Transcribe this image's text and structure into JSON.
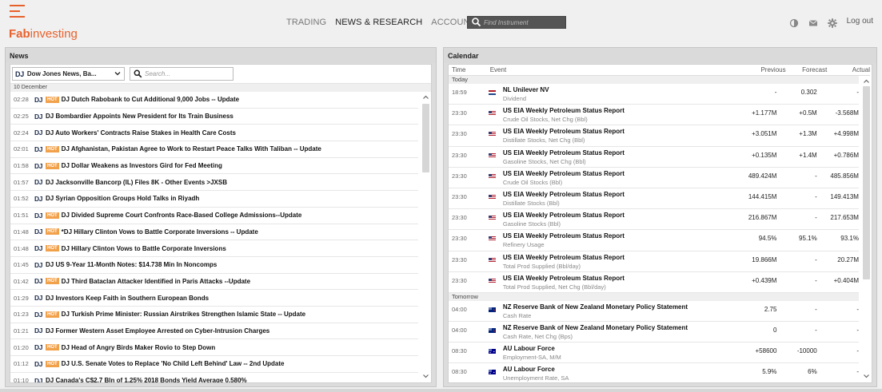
{
  "header": {
    "logo_fab": "Fab",
    "logo_rest": "investing",
    "nav": [
      {
        "label": "TRADING",
        "active": false
      },
      {
        "label": "NEWS & RESEARCH",
        "active": true
      },
      {
        "label": "ACCOUNT",
        "active": false
      }
    ],
    "find_placeholder": "Find Instrument",
    "logout": "Log out",
    "icons": [
      "contrast-icon",
      "mail-icon",
      "gear-icon"
    ]
  },
  "news": {
    "title": "News",
    "source_value": "Dow Jones News, Ba...",
    "source_mark": "DJ",
    "search_placeholder": "Search...",
    "date_label": "10 December",
    "hot_label": "HOT",
    "items": [
      {
        "time": "02:28",
        "hot": true,
        "headline": "DJ Dutch Rabobank to Cut Additional 9,000 Jobs -- Update"
      },
      {
        "time": "02:25",
        "hot": false,
        "headline": "DJ Bombardier Appoints New President for Its Train Business"
      },
      {
        "time": "02:24",
        "hot": false,
        "headline": "DJ Auto Workers' Contracts Raise Stakes in Health Care Costs"
      },
      {
        "time": "02:01",
        "hot": true,
        "headline": "DJ Afghanistan, Pakistan Agree to Work to Restart Peace Talks With Taliban -- Update"
      },
      {
        "time": "01:58",
        "hot": true,
        "headline": "DJ Dollar Weakens as Investors Gird for Fed Meeting"
      },
      {
        "time": "01:57",
        "hot": false,
        "headline": "DJ Jacksonville Bancorp (IL) Files 8K - Other Events >JXSB"
      },
      {
        "time": "01:52",
        "hot": false,
        "headline": "DJ Syrian Opposition Groups Hold Talks in Riyadh"
      },
      {
        "time": "01:51",
        "hot": true,
        "headline": "DJ Divided Supreme Court Confronts Race-Based College Admissions--Update"
      },
      {
        "time": "01:48",
        "hot": true,
        "headline": "*DJ Hillary Clinton Vows to Battle Corporate Inversions -- Update"
      },
      {
        "time": "01:48",
        "hot": true,
        "headline": "DJ Hillary Clinton Vows to Battle Corporate Inversions"
      },
      {
        "time": "01:45",
        "hot": false,
        "headline": "DJ US 9-Year 11-Month Notes: $14.738 Min In Noncomps"
      },
      {
        "time": "01:42",
        "hot": true,
        "headline": "DJ Third Bataclan Attacker Identified in Paris Attacks --Update"
      },
      {
        "time": "01:29",
        "hot": false,
        "headline": "DJ Investors Keep Faith in Southern European Bonds"
      },
      {
        "time": "01:23",
        "hot": true,
        "headline": "DJ Turkish Prime Minister: Russian Airstrikes Strengthen Islamic State -- Update"
      },
      {
        "time": "01:21",
        "hot": false,
        "headline": "DJ Former Western Asset Employee Arrested on Cyber-Intrusion Charges"
      },
      {
        "time": "01:20",
        "hot": true,
        "headline": "DJ Head of Angry Birds Maker Rovio to Step Down"
      },
      {
        "time": "01:12",
        "hot": true,
        "headline": "DJ U.S. Senate Votes to Replace 'No Child Left Behind' Law -- 2nd Update"
      },
      {
        "time": "01:10",
        "hot": false,
        "headline": "DJ Canada's C$2.7 Bln of 1.25% 2018 Bonds Yield Average 0.580%"
      }
    ]
  },
  "calendar": {
    "title": "Calendar",
    "columns": {
      "time": "Time",
      "event": "Event",
      "previous": "Previous",
      "forecast": "Forecast",
      "actual": "Actual"
    },
    "sections": [
      {
        "label": "Today",
        "rows": [
          {
            "time": "18:59",
            "flag": "nl",
            "name": "NL Unilever NV",
            "sub": "Dividend",
            "previous": "-",
            "forecast": "0.302",
            "actual": "-"
          },
          {
            "time": "23:30",
            "flag": "us",
            "name": "US EIA Weekly Petroleum Status Report",
            "sub": "Crude Oil Stocks, Net Chg (Bbl)",
            "previous": "+1.177M",
            "forecast": "+0.5M",
            "actual": "-3.568M"
          },
          {
            "time": "23:30",
            "flag": "us",
            "name": "US EIA Weekly Petroleum Status Report",
            "sub": "Distillate Stocks, Net Chg (Bbl)",
            "previous": "+3.051M",
            "forecast": "+1.3M",
            "actual": "+4.998M"
          },
          {
            "time": "23:30",
            "flag": "us",
            "name": "US EIA Weekly Petroleum Status Report",
            "sub": "Gasoline Stocks, Net Chg (Bbl)",
            "previous": "+0.135M",
            "forecast": "+1.4M",
            "actual": "+0.786M"
          },
          {
            "time": "23:30",
            "flag": "us",
            "name": "US EIA Weekly Petroleum Status Report",
            "sub": "Crude Oil Stocks (Bbl)",
            "previous": "489.424M",
            "forecast": "-",
            "actual": "485.856M"
          },
          {
            "time": "23:30",
            "flag": "us",
            "name": "US EIA Weekly Petroleum Status Report",
            "sub": "Distillate Stocks (Bbl)",
            "previous": "144.415M",
            "forecast": "-",
            "actual": "149.413M"
          },
          {
            "time": "23:30",
            "flag": "us",
            "name": "US EIA Weekly Petroleum Status Report",
            "sub": "Gasoline Stocks (Bbl)",
            "previous": "216.867M",
            "forecast": "-",
            "actual": "217.653M"
          },
          {
            "time": "23:30",
            "flag": "us",
            "name": "US EIA Weekly Petroleum Status Report",
            "sub": "Refinery Usage",
            "previous": "94.5%",
            "forecast": "95.1%",
            "actual": "93.1%"
          },
          {
            "time": "23:30",
            "flag": "us",
            "name": "US EIA Weekly Petroleum Status Report",
            "sub": "Total Prod Supplied (Bbl/day)",
            "previous": "19.866M",
            "forecast": "-",
            "actual": "20.27M"
          },
          {
            "time": "23:30",
            "flag": "us",
            "name": "US EIA Weekly Petroleum Status Report",
            "sub": "Total Prod Supplied, Net Chg (Bbl/day)",
            "previous": "+0.439M",
            "forecast": "-",
            "actual": "+0.404M"
          }
        ]
      },
      {
        "label": "Tomorrow",
        "rows": [
          {
            "time": "04:00",
            "flag": "nz",
            "name": "NZ Reserve Bank of New Zealand Monetary Policy Statement",
            "sub": "Cash Rate",
            "previous": "2.75",
            "forecast": "-",
            "actual": "-"
          },
          {
            "time": "04:00",
            "flag": "nz",
            "name": "NZ Reserve Bank of New Zealand Monetary Policy Statement",
            "sub": "Cash Rate, Net Chg (Bps)",
            "previous": "0",
            "forecast": "-",
            "actual": "-"
          },
          {
            "time": "08:30",
            "flag": "au",
            "name": "AU Labour Force",
            "sub": "Employment-SA, M/M",
            "previous": "+58600",
            "forecast": "-10000",
            "actual": "-"
          },
          {
            "time": "08:30",
            "flag": "au",
            "name": "AU Labour Force",
            "sub": "Unemployment Rate, SA",
            "previous": "5.9%",
            "forecast": "6%",
            "actual": "-"
          }
        ]
      }
    ]
  }
}
